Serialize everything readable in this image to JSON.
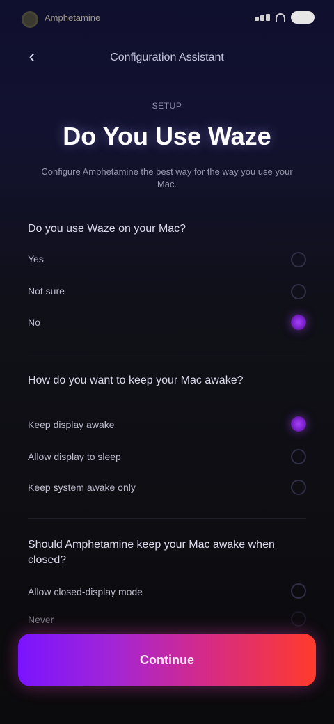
{
  "status_bar": {
    "left_text": "Amphetamine",
    "right_icons": [
      "signal-bars-icon",
      "wifi-icon",
      "battery-icon"
    ]
  },
  "header": {
    "back_icon": "chevron-left-icon",
    "title": "Configuration Assistant"
  },
  "hero": {
    "kicker": "SETUP",
    "title": "Do You Use Waze",
    "subtitle": "Configure Amphetamine the best way for the way you use your Mac."
  },
  "sections": [
    {
      "question": "Do you use Waze on your Mac?",
      "options": [
        {
          "label": "Yes",
          "selected": false
        },
        {
          "label": "Not sure",
          "selected": false
        },
        {
          "label": "No",
          "selected": true
        }
      ]
    },
    {
      "question": "How do you want to keep your Mac awake?",
      "options": [
        {
          "label": "Keep display awake",
          "selected": true
        },
        {
          "label": "Allow display to sleep",
          "selected": false
        },
        {
          "label": "Keep system awake only",
          "selected": false
        }
      ]
    },
    {
      "question": "Should Amphetamine keep your Mac awake when closed?",
      "options": [
        {
          "label": "Allow closed-display mode",
          "selected": false
        },
        {
          "label": "Never",
          "selected": false
        }
      ]
    }
  ],
  "cta": {
    "label": "Continue"
  },
  "colors": {
    "accent_purple": "#8A2BE2",
    "accent_red": "#FF3B2B"
  }
}
